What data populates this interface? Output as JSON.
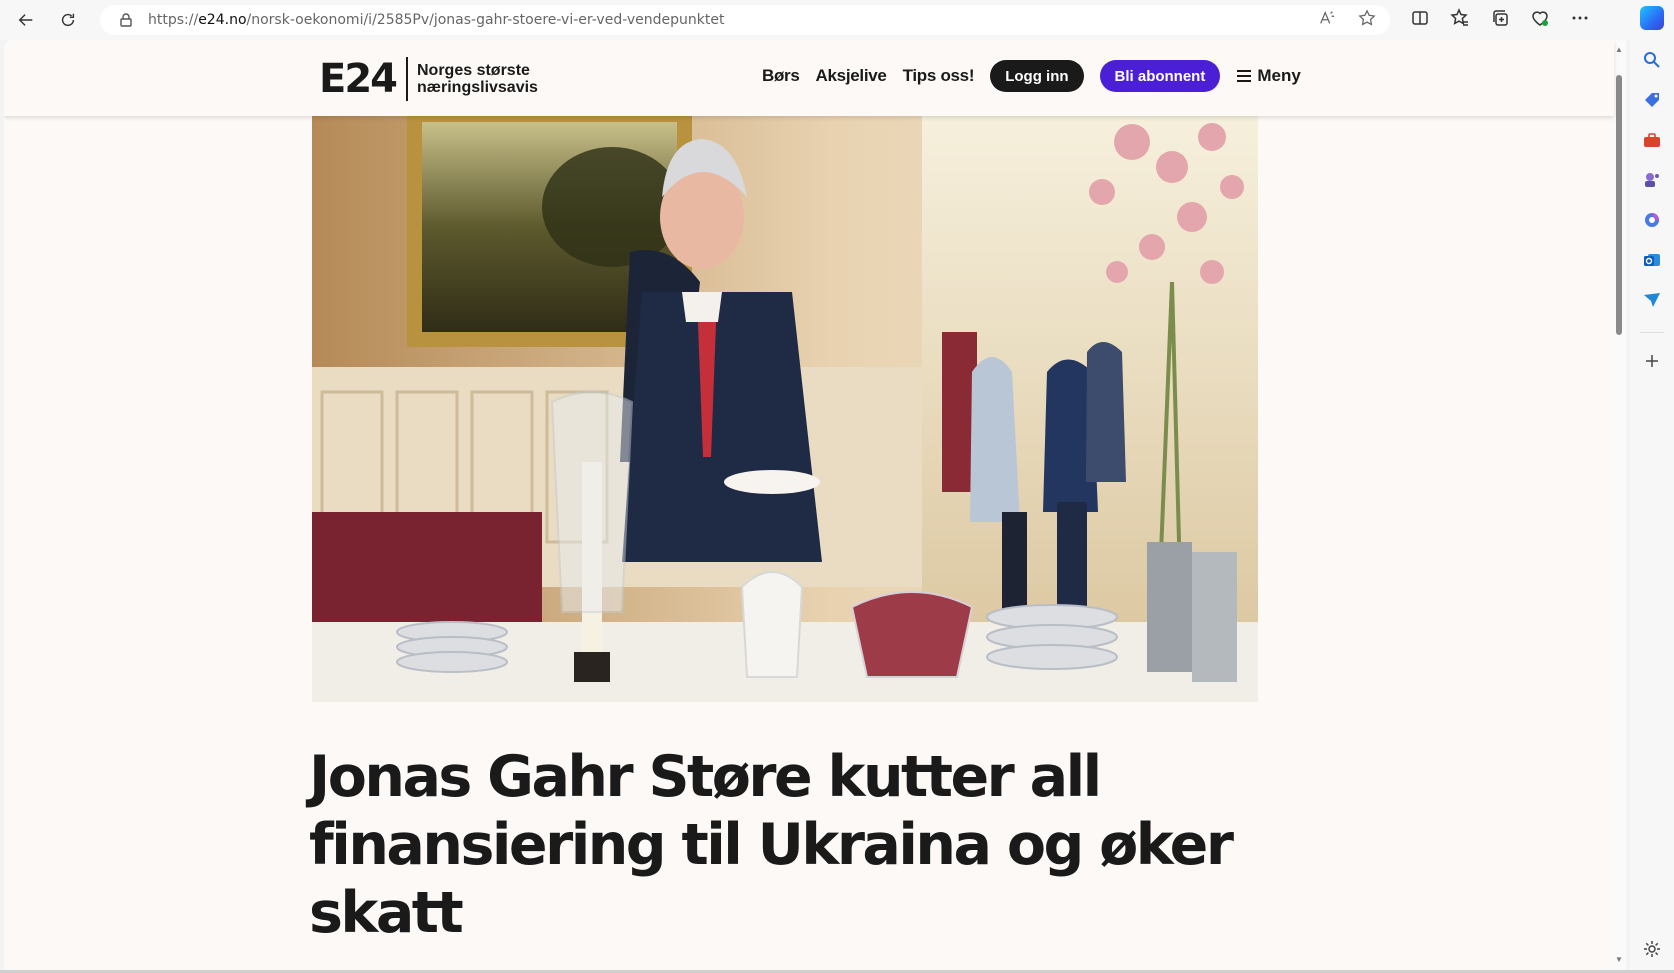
{
  "browser": {
    "url_prefix": "https://",
    "url_host": "e24.no",
    "url_path": "/norsk-oekonomi/i/2585Pv/jonas-gahr-stoere-vi-er-ved-vendepunktet",
    "icons": [
      "back-icon",
      "reload-icon",
      "lock-icon",
      "read-aloud-icon",
      "favorite-star-icon",
      "split-screen-icon",
      "favorites-icon",
      "collections-icon",
      "browser-essentials-icon",
      "more-icon",
      "copilot-icon"
    ],
    "sidebar_icons": [
      "search-icon",
      "shopping-tag-icon",
      "toolbox-icon",
      "games-icon",
      "office-icon",
      "outlook-icon",
      "send-icon",
      "add-icon",
      "settings-icon"
    ]
  },
  "site": {
    "logo": "E24",
    "tagline_line1": "Norges største",
    "tagline_line2": "næringslivsavis",
    "nav": {
      "bors": "Børs",
      "aksjelive": "Aksjelive",
      "tips": "Tips oss!",
      "login": "Logg inn",
      "subscribe": "Bli abonnent",
      "menu": "Meny"
    },
    "colors": {
      "background": "#fcf9f6",
      "subscribe_button": "#4a1fd6",
      "login_button": "#1a1a1a"
    }
  },
  "article": {
    "headline": "Jonas Gahr Støre kutter all finansiering til Ukraina og øker skatt"
  }
}
